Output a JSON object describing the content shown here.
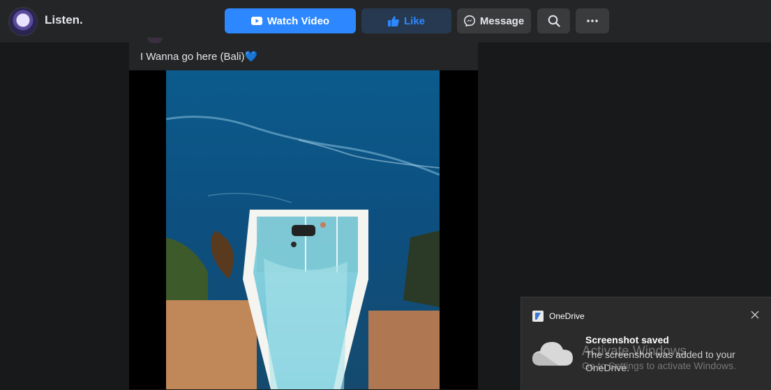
{
  "header": {
    "page_name": "Listen.",
    "buttons": {
      "watch_video": "Watch Video",
      "like": "Like",
      "message": "Message"
    },
    "icons": [
      "search-icon",
      "more-icon",
      "play-icon",
      "thumbs-up-icon",
      "messenger-icon"
    ]
  },
  "post": {
    "caption": "I Wanna go here (Bali)💙"
  },
  "notification": {
    "app_name": "OneDrive",
    "title": "Screenshot saved",
    "body": "The screenshot was added to your OneDrive."
  },
  "watermark": {
    "title": "Activate Windows",
    "subtitle": "Go to Settings to activate Windows."
  },
  "colors": {
    "background": "#18191a",
    "topbar": "#242526",
    "primary_button": "#2d88ff",
    "like_button": "#263951",
    "secondary_button": "#3a3b3c",
    "toast_background": "#2b2b2b"
  }
}
